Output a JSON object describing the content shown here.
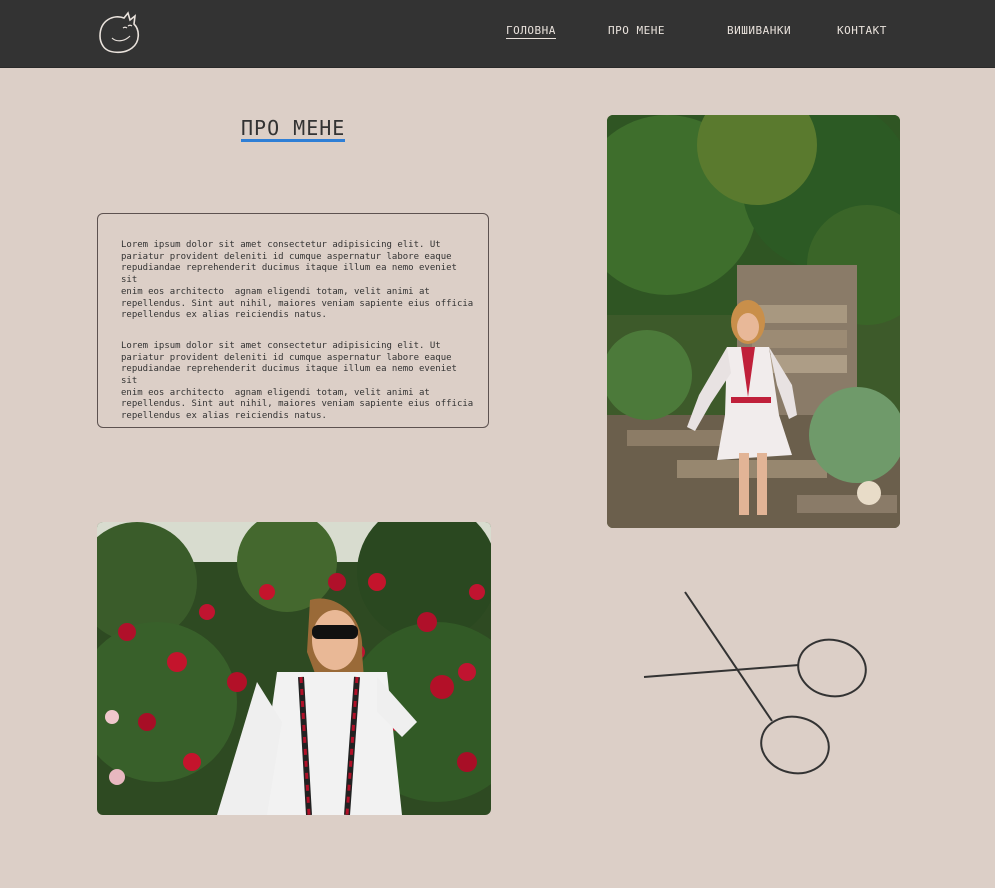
{
  "header": {
    "logo_icon": "cat-logo-icon",
    "nav": [
      {
        "label": "ГОЛОВНА",
        "active": true
      },
      {
        "label": "ПРО МЕНЕ",
        "active": false
      },
      {
        "label": "ВИШИВАНКИ",
        "active": false
      },
      {
        "label": "КОНТАКТ",
        "active": false
      }
    ]
  },
  "main": {
    "title": "ПРО МЕНЕ",
    "paragraphs": [
      "Lorem ipsum dolor sit amet consectetur adipisicing elit. Ut\npariatur provident deleniti id cumque aspernatur labore eaque\nrepudiandae reprehenderit ducimus itaque illum ea nemo eveniet sit\nenim eos architecto  agnam eligendi totam, velit animi at\nrepellendus. Sint aut nihil, maiores veniam sapiente eius officia\nrepellendus ex alias reiciendis natus.",
      "Lorem ipsum dolor sit amet consectetur adipisicing elit. Ut\npariatur provident deleniti id cumque aspernatur labore eaque\nrepudiandae reprehenderit ducimus itaque illum ea nemo eveniet sit\nenim eos architecto  agnam eligendi totam, velit animi at\nrepellendus. Sint aut nihil, maiores veniam sapiente eius officia\nrepellendus ex alias reiciendis natus."
    ],
    "decor_icon": "scissors-icon"
  },
  "colors": {
    "background": "#dccfc7",
    "header": "#333333",
    "nav_text": "#e9e2dc",
    "title_underline": "#2f7fd6",
    "text": "#333333"
  }
}
